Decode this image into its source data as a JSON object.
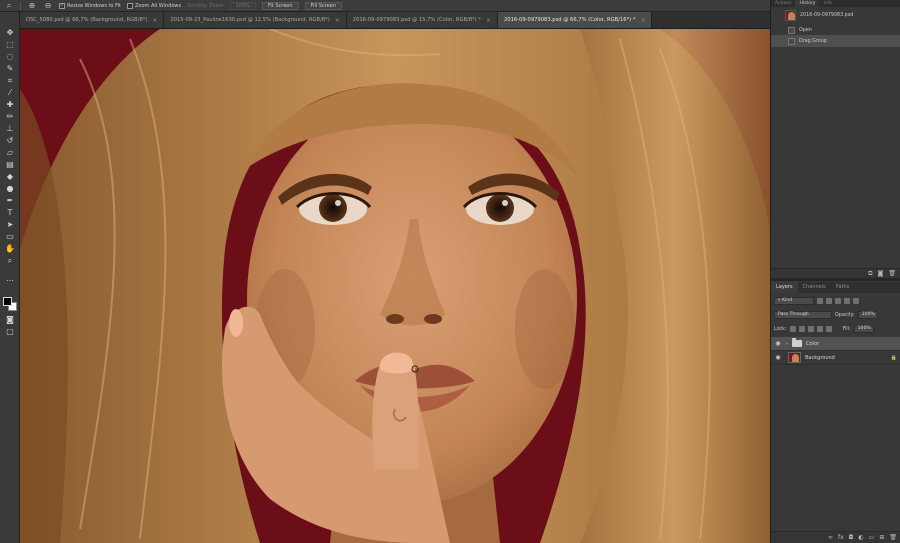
{
  "options_bar": {
    "resize_windows_label": "Resize Windows to Fit",
    "zoom_all_label": "Zoom All Windows",
    "scrubby_zoom_label": "Scrubby Zoom",
    "zoom_level": "100%",
    "fit_screen_label": "Fit Screen",
    "fill_screen_label": "Fill Screen"
  },
  "tabs": [
    {
      "label": "DSC_5080.psd @ 66,7% (Background, RGB/8*)"
    },
    {
      "label": "2015-09-23_Pauline1630.psd @ 12,5% (Background, RGB/8*)"
    },
    {
      "label": "2016-09-0979083.psd @ 15,7% (Color, RGB/8*) *"
    },
    {
      "label": "2016-09-0979083.psd @ 66,7% (Color, RGB/16*) *"
    }
  ],
  "history": {
    "tabs": [
      "Actions",
      "History",
      "Info"
    ],
    "snapshot_name": "2016-09-0979083.psd",
    "states": [
      "Open",
      "Drag Group"
    ]
  },
  "layers_panel": {
    "tabs": [
      "Layers",
      "Channels",
      "Paths"
    ],
    "filter_kind": "Kind",
    "blend_mode": "Pass Through",
    "opacity_label": "Opacity:",
    "opacity_value": "100%",
    "lock_label": "Lock:",
    "fill_label": "Fill:",
    "fill_value": "100%",
    "layers": [
      {
        "name": "Color",
        "type": "group",
        "selected": true
      },
      {
        "name": "Background",
        "type": "image",
        "selected": false
      }
    ]
  },
  "colors": {
    "canvas_background": "#6b0e18",
    "hair": "#b9834c",
    "skin": "#c98a5c",
    "panel": "#383838"
  }
}
